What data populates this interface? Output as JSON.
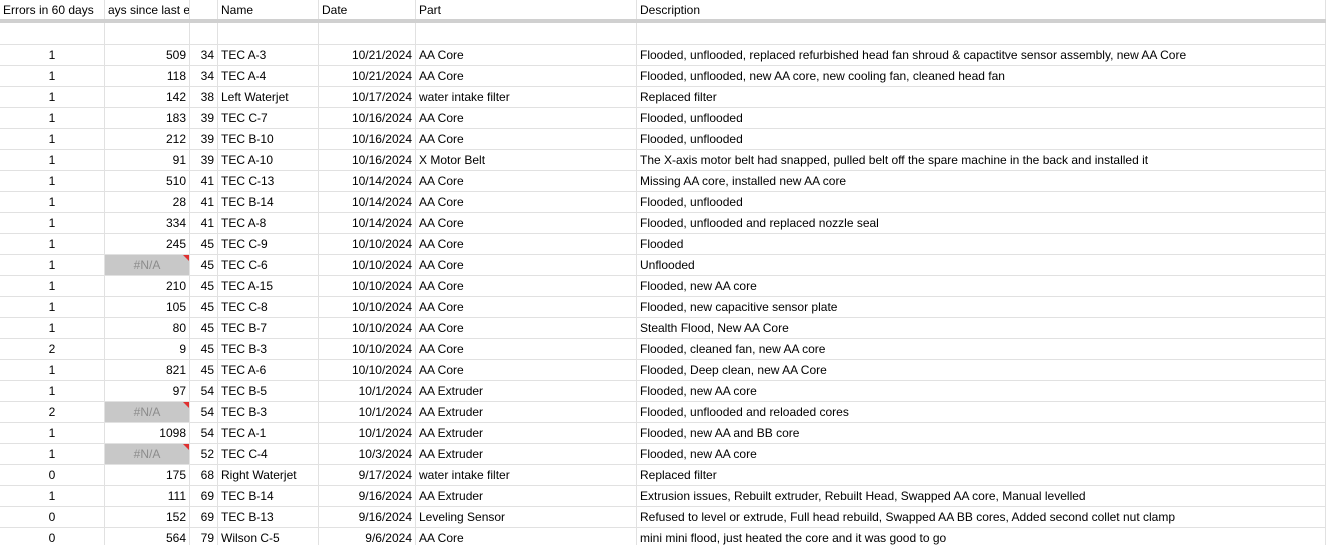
{
  "headers": {
    "errors": "Errors in 60 days",
    "days_since": "Days since last error",
    "days_since_display": "ays since last errys sir",
    "short": "",
    "name": "Name",
    "date": "Date",
    "part": "Part",
    "description": "Description"
  },
  "rows": [
    {
      "errors": "",
      "days": "",
      "short": "",
      "name": "",
      "date": "",
      "part": "",
      "desc": "",
      "na": false
    },
    {
      "errors": "1",
      "days": "509",
      "short": "34",
      "name": "TEC A-3",
      "date": "10/21/2024",
      "part": "AA Core",
      "desc": "Flooded, unflooded, replaced refurbished head fan shroud & capactitve sensor assembly, new AA Core",
      "na": false
    },
    {
      "errors": "1",
      "days": "118",
      "short": "34",
      "name": "TEC A-4",
      "date": "10/21/2024",
      "part": "AA Core",
      "desc": "Flooded, unflooded, new AA core, new cooling fan, cleaned head fan",
      "na": false
    },
    {
      "errors": "1",
      "days": "142",
      "short": "38",
      "name": "Left Waterjet",
      "date": "10/17/2024",
      "part": "water intake filter",
      "desc": "Replaced filter",
      "na": false
    },
    {
      "errors": "1",
      "days": "183",
      "short": "39",
      "name": "TEC C-7",
      "date": "10/16/2024",
      "part": "AA Core",
      "desc": "Flooded, unflooded",
      "na": false
    },
    {
      "errors": "1",
      "days": "212",
      "short": "39",
      "name": "TEC B-10",
      "date": "10/16/2024",
      "part": "AA Core",
      "desc": "Flooded, unflooded",
      "na": false
    },
    {
      "errors": "1",
      "days": "91",
      "short": "39",
      "name": "TEC A-10",
      "date": "10/16/2024",
      "part": "X Motor Belt",
      "desc": "The X-axis motor belt had snapped, pulled belt off the spare machine in the back and installed it",
      "na": false
    },
    {
      "errors": "1",
      "days": "510",
      "short": "41",
      "name": "TEC C-13",
      "date": "10/14/2024",
      "part": "AA Core",
      "desc": "Missing AA core, installed new AA core",
      "na": false
    },
    {
      "errors": "1",
      "days": "28",
      "short": "41",
      "name": "TEC B-14",
      "date": "10/14/2024",
      "part": "AA Core",
      "desc": "Flooded, unflooded",
      "na": false
    },
    {
      "errors": "1",
      "days": "334",
      "short": "41",
      "name": "TEC A-8",
      "date": "10/14/2024",
      "part": "AA Core",
      "desc": "Flooded, unflooded and replaced nozzle seal",
      "na": false
    },
    {
      "errors": "1",
      "days": "245",
      "short": "45",
      "name": "TEC C-9",
      "date": "10/10/2024",
      "part": "AA Core",
      "desc": "Flooded",
      "na": false
    },
    {
      "errors": "1",
      "days": "#N/A",
      "short": "45",
      "name": "TEC C-6",
      "date": "10/10/2024",
      "part": "AA Core",
      "desc": "Unflooded",
      "na": true
    },
    {
      "errors": "1",
      "days": "210",
      "short": "45",
      "name": "TEC A-15",
      "date": "10/10/2024",
      "part": "AA Core",
      "desc": "Flooded, new AA core",
      "na": false
    },
    {
      "errors": "1",
      "days": "105",
      "short": "45",
      "name": "TEC C-8",
      "date": "10/10/2024",
      "part": "AA Core",
      "desc": "Flooded, new capacitive sensor plate",
      "na": false
    },
    {
      "errors": "1",
      "days": "80",
      "short": "45",
      "name": "TEC B-7",
      "date": "10/10/2024",
      "part": "AA Core",
      "desc": "Stealth Flood, New AA Core",
      "na": false
    },
    {
      "errors": "2",
      "days": "9",
      "short": "45",
      "name": "TEC B-3",
      "date": "10/10/2024",
      "part": "AA Core",
      "desc": "Flooded, cleaned fan, new AA core",
      "na": false
    },
    {
      "errors": "1",
      "days": "821",
      "short": "45",
      "name": "TEC A-6",
      "date": "10/10/2024",
      "part": "AA Core",
      "desc": "Flooded, Deep clean, new AA Core",
      "na": false
    },
    {
      "errors": "1",
      "days": "97",
      "short": "54",
      "name": "TEC B-5",
      "date": "10/1/2024",
      "part": "AA Extruder",
      "desc": "Flooded, new AA core",
      "na": false
    },
    {
      "errors": "2",
      "days": "#N/A",
      "short": "54",
      "name": "TEC B-3",
      "date": "10/1/2024",
      "part": "AA Extruder",
      "desc": "Flooded, unflooded and reloaded cores",
      "na": true
    },
    {
      "errors": "1",
      "days": "1098",
      "short": "54",
      "name": "TEC A-1",
      "date": "10/1/2024",
      "part": "AA Extruder",
      "desc": "Flooded, new AA and BB core",
      "na": false
    },
    {
      "errors": "1",
      "days": "#N/A",
      "short": "52",
      "name": "TEC C-4",
      "date": "10/3/2024",
      "part": "AA Extruder",
      "desc": "Flooded, new AA core",
      "na": true
    },
    {
      "errors": "0",
      "days": "175",
      "short": "68",
      "name": "Right Waterjet",
      "date": "9/17/2024",
      "part": "water intake filter",
      "desc": "Replaced filter",
      "na": false
    },
    {
      "errors": "1",
      "days": "111",
      "short": "69",
      "name": "TEC B-14",
      "date": "9/16/2024",
      "part": "AA Extruder",
      "desc": "Extrusion issues, Rebuilt extruder, Rebuilt Head, Swapped AA core, Manual levelled",
      "na": false
    },
    {
      "errors": "0",
      "days": "152",
      "short": "69",
      "name": "TEC B-13",
      "date": "9/16/2024",
      "part": "Leveling Sensor",
      "desc": "Refused to level or extrude, Full head rebuild, Swapped AA BB cores, Added second collet nut clamp",
      "na": false
    },
    {
      "errors": "0",
      "days": "564",
      "short": "79",
      "name": "Wilson C-5",
      "date": "9/6/2024",
      "part": "AA Core",
      "desc": "mini mini flood, just heated the core and it was good to go",
      "na": false
    }
  ]
}
